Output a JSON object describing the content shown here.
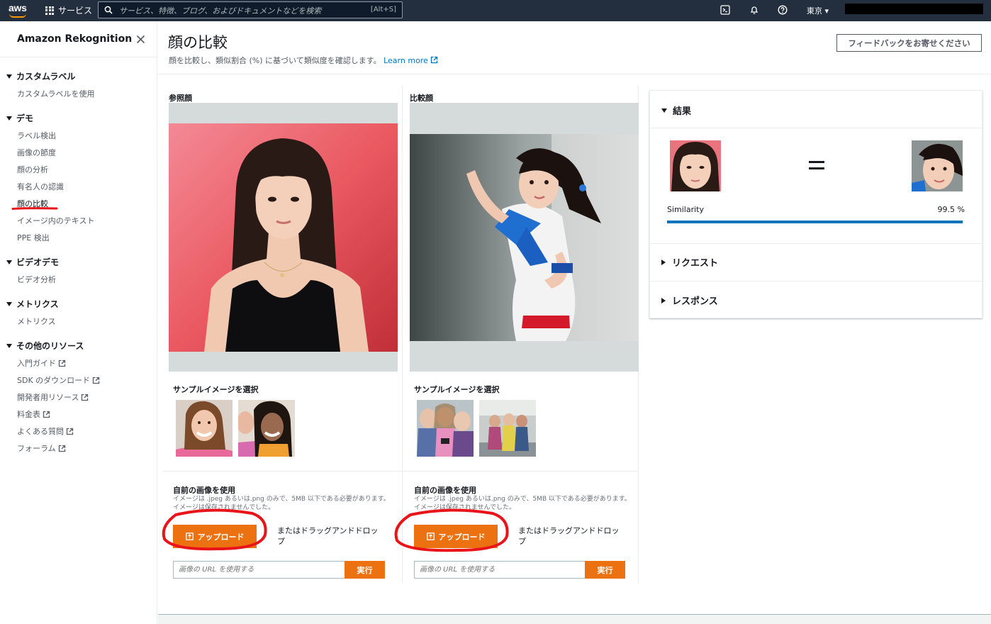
{
  "topnav": {
    "logo_text": "aws",
    "services_label": "サービス",
    "search_placeholder": "サービス、特徴、ブログ、およびドキュメントなどを検索",
    "search_shortcut": "[Alt+S]",
    "region_label": "東京 ▾"
  },
  "sidebar": {
    "title": "Amazon Rekognition",
    "sections": [
      {
        "label": "カスタムラベル",
        "items": [
          {
            "label": "カスタムラベルを使用"
          }
        ]
      },
      {
        "label": "デモ",
        "items": [
          {
            "label": "ラベル検出"
          },
          {
            "label": "画像の節度"
          },
          {
            "label": "顔の分析"
          },
          {
            "label": "有名人の認識"
          },
          {
            "label": "顔の比較"
          },
          {
            "label": "イメージ内のテキスト"
          },
          {
            "label": "PPE 検出"
          }
        ]
      },
      {
        "label": "ビデオデモ",
        "items": [
          {
            "label": "ビデオ分析"
          }
        ]
      },
      {
        "label": "メトリクス",
        "items": [
          {
            "label": "メトリクス"
          }
        ]
      },
      {
        "label": "その他のリソース",
        "items": [
          {
            "label": "入門ガイド"
          },
          {
            "label": "SDK のダウンロード"
          },
          {
            "label": "開発者用リソース"
          },
          {
            "label": "料金表"
          },
          {
            "label": "よくある質問"
          },
          {
            "label": "フォーラム"
          }
        ]
      }
    ]
  },
  "header": {
    "title": "顔の比較",
    "description": "顔を比較し、類似割合 (%) に基づいて類似度を確認します。",
    "learn_more": "Learn more",
    "feedback_button": "フィードバックをお寄せください"
  },
  "panels": {
    "reference": {
      "label": "参照顔",
      "sample_title": "サンプルイメージを選択",
      "own_title": "自前の画像を使用",
      "own_desc": "イメージは .jpeg あるいは.png のみで、5MB 以下である必要があります。イメージは保存されませんでした。",
      "upload_label": "アップロード",
      "drag_text": "またはドラッグアンドドロップ",
      "url_placeholder": "画像の URL を使用する",
      "run_label": "実行"
    },
    "comparison": {
      "label": "比較顔",
      "sample_title": "サンプルイメージを選択",
      "own_title": "自前の画像を使用",
      "own_desc": "イメージは .jpeg あるいは.png のみで、5MB 以下である必要があります。イメージは保存されませんでした。",
      "upload_label": "アップロード",
      "drag_text": "またはドラッグアンドドロップ",
      "url_placeholder": "画像の URL を使用する",
      "run_label": "実行"
    }
  },
  "results": {
    "title": "結果",
    "similarity_label": "Similarity",
    "similarity_value": "99.5 %",
    "similarity_fraction": 0.995,
    "request_label": "リクエスト",
    "response_label": "レスポンス"
  },
  "colors": {
    "nav_bg": "#232f3e",
    "accent_orange": "#ec7211",
    "link_blue": "#0073bb",
    "annotation_red": "#e8141a"
  }
}
